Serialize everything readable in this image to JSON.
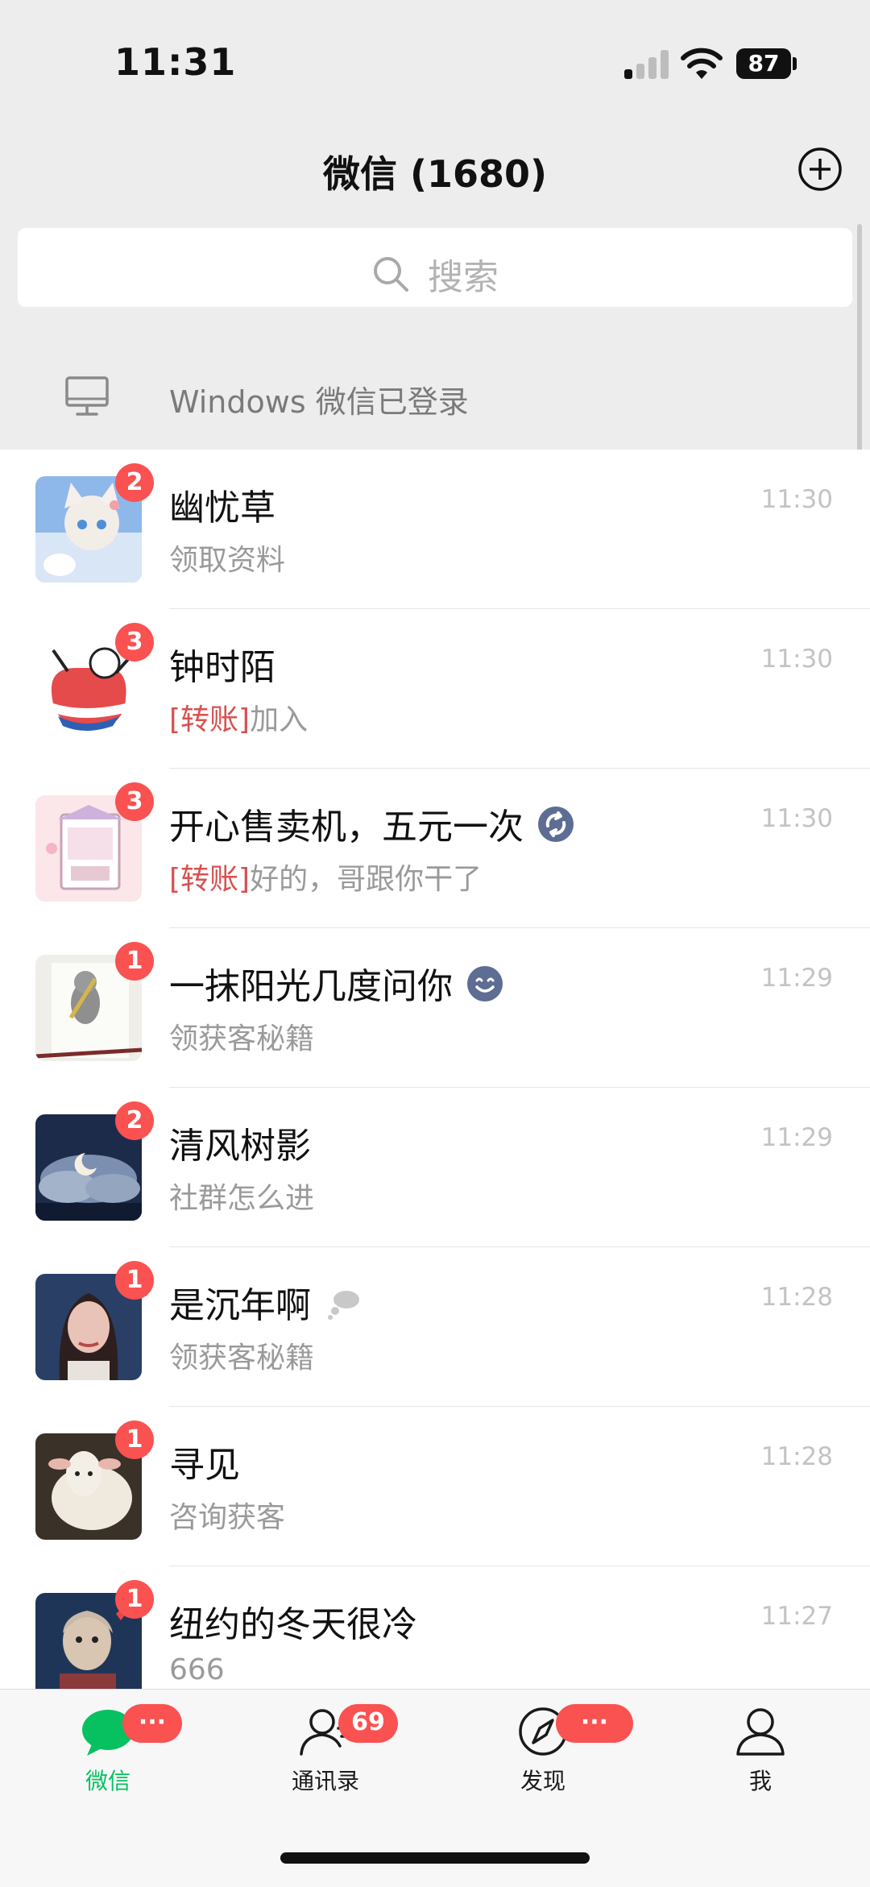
{
  "status_bar": {
    "time": "11:31",
    "battery": "87"
  },
  "header": {
    "title": "微信 (1680)"
  },
  "search": {
    "placeholder": "搜索"
  },
  "login_notice": {
    "text": "Windows 微信已登录"
  },
  "chats": [
    {
      "name": "幽忧草",
      "preview": "领取资料",
      "tag": "",
      "time": "11:30",
      "unread": "2"
    },
    {
      "name": "钟时陌",
      "preview": "加入",
      "tag": "[转账]",
      "time": "11:30",
      "unread": "3"
    },
    {
      "name": "开心售卖机，五元一次",
      "preview": "好的，哥跟你干了",
      "tag": "[转账]",
      "time": "11:30",
      "unread": "3",
      "icon": "refresh-badge-icon"
    },
    {
      "name": "一抹阳光几度问你",
      "preview": "领获客秘籍",
      "tag": "",
      "time": "11:29",
      "unread": "1",
      "icon": "smile-emoji-icon"
    },
    {
      "name": "清风树影",
      "preview": "社群怎么进",
      "tag": "",
      "time": "11:29",
      "unread": "2"
    },
    {
      "name": "是沉年啊",
      "preview": "领获客秘籍",
      "tag": "",
      "time": "11:28",
      "unread": "1",
      "icon": "thought-cloud-icon"
    },
    {
      "name": "寻见",
      "preview": "咨询获客",
      "tag": "",
      "time": "11:28",
      "unread": "1"
    },
    {
      "name": "纽约的冬天很冷",
      "preview": "666",
      "tag": "",
      "time": "11:27",
      "unread": "1"
    }
  ],
  "tabs": [
    {
      "label": "微信",
      "badge": "···",
      "icon": "chat-bubble-icon",
      "active": true
    },
    {
      "label": "通讯录",
      "badge": "69",
      "icon": "contacts-icon",
      "active": false
    },
    {
      "label": "发现",
      "badge": "···",
      "icon": "compass-icon",
      "active": false
    },
    {
      "label": "我",
      "badge": "",
      "icon": "person-icon",
      "active": false
    }
  ],
  "colors": {
    "accent": "#07c160",
    "badge": "#fa5151",
    "transfer_tag": "#d95050"
  }
}
